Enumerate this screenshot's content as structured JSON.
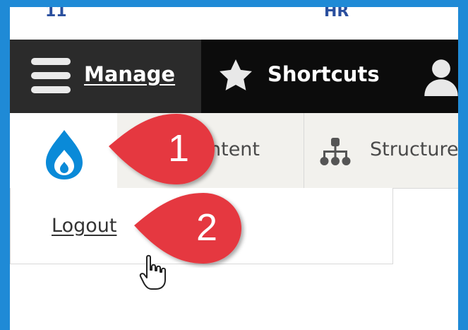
{
  "top_strip": {
    "fragment_left": "11",
    "fragment_right": "HR"
  },
  "toolbar": {
    "manage_label": "Manage",
    "shortcuts_label": "Shortcuts"
  },
  "admin_tray": {
    "content_label": "ntent",
    "structure_label": "Structure"
  },
  "dropdown": {
    "logout_label": "Logout"
  },
  "callouts": [
    {
      "number": "1",
      "target": "drupal-icon"
    },
    {
      "number": "2",
      "target": "logout-link"
    }
  ],
  "icons": {
    "menu": "hamburger-menu-icon",
    "star": "star-icon",
    "user": "user-icon",
    "drupal": "drupal-drop-icon",
    "structure": "sitemap-icon",
    "cursor": "hand-pointer-cursor-icon"
  },
  "colors": {
    "frame": "#1f8ad6",
    "toolbar": "#0c0c0c",
    "manage_tab": "#2b2b2b",
    "drupal_blue": "#0a8ad8",
    "callout_red": "#e5373f",
    "tray": "#f2f1ed"
  }
}
